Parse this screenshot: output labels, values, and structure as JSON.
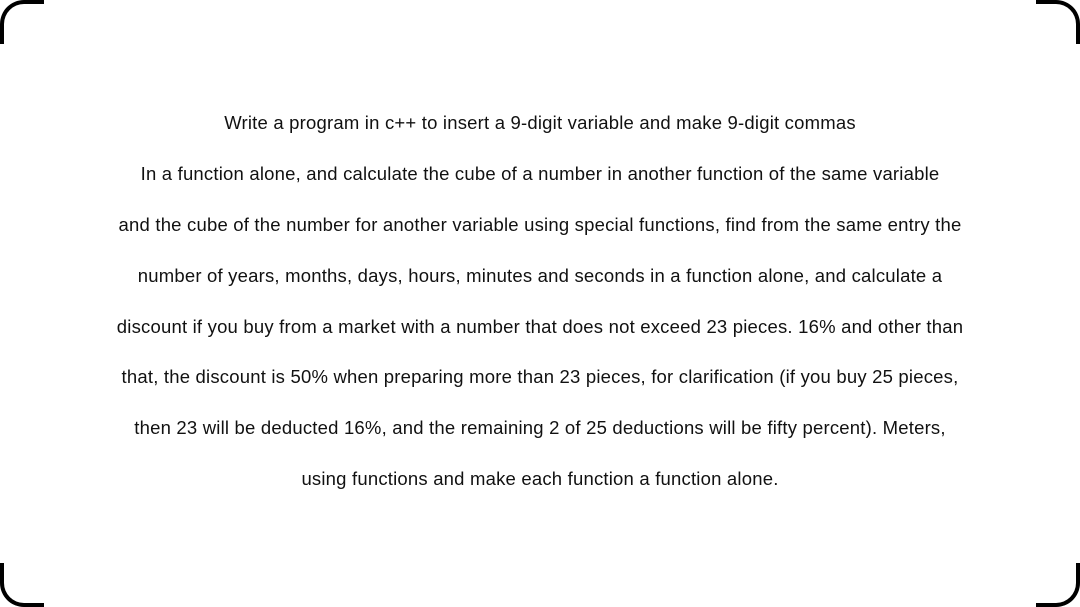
{
  "lines": [
    "Write a program in c++  to insert a 9-digit variable and make 9-digit commas",
    "In a function alone, and calculate the cube of a number in another function of the same variable",
    "and the cube of the number for another variable using special functions, find from the same entry the",
    "number of years, months, days, hours, minutes and seconds in a function alone, and calculate a",
    "discount if you buy from a market with a number that does not exceed 23 pieces.   16% and other than",
    "that, the discount is 50% when preparing more than 23 pieces, for clarification (if you buy 25 pieces,",
    "then 23 will be deducted 16%, and the remaining 2 of 25 deductions will be fifty percent).  Meters,",
    "using functions and make each function a function alone."
  ]
}
